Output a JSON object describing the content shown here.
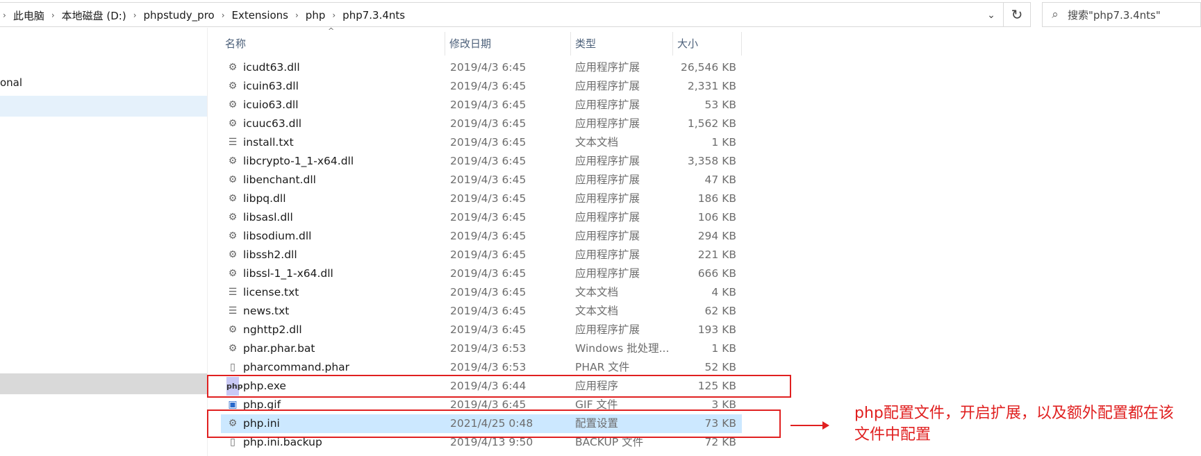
{
  "address": {
    "crumbs": [
      "此电脑",
      "本地磁盘 (D:)",
      "phpstudy_pro",
      "Extensions",
      "php",
      "php7.3.4nts"
    ],
    "dropdown_glyph": "⌄",
    "refresh_glyph": "↻"
  },
  "search": {
    "placeholder": "搜索\"php7.3.4nts\""
  },
  "nav": {
    "partial_item": "onal"
  },
  "columns": {
    "name": "名称",
    "date": "修改日期",
    "type": "类型",
    "size": "大小"
  },
  "files": [
    {
      "name": "icudt63.dll",
      "date": "2019/4/3 6:45",
      "type": "应用程序扩展",
      "size": "26,546 KB",
      "icon": "dll-icon"
    },
    {
      "name": "icuin63.dll",
      "date": "2019/4/3 6:45",
      "type": "应用程序扩展",
      "size": "2,331 KB",
      "icon": "dll-icon"
    },
    {
      "name": "icuio63.dll",
      "date": "2019/4/3 6:45",
      "type": "应用程序扩展",
      "size": "53 KB",
      "icon": "dll-icon"
    },
    {
      "name": "icuuc63.dll",
      "date": "2019/4/3 6:45",
      "type": "应用程序扩展",
      "size": "1,562 KB",
      "icon": "dll-icon"
    },
    {
      "name": "install.txt",
      "date": "2019/4/3 6:45",
      "type": "文本文档",
      "size": "1 KB",
      "icon": "text-file-icon"
    },
    {
      "name": "libcrypto-1_1-x64.dll",
      "date": "2019/4/3 6:45",
      "type": "应用程序扩展",
      "size": "3,358 KB",
      "icon": "dll-icon"
    },
    {
      "name": "libenchant.dll",
      "date": "2019/4/3 6:45",
      "type": "应用程序扩展",
      "size": "47 KB",
      "icon": "dll-icon"
    },
    {
      "name": "libpq.dll",
      "date": "2019/4/3 6:45",
      "type": "应用程序扩展",
      "size": "186 KB",
      "icon": "dll-icon"
    },
    {
      "name": "libsasl.dll",
      "date": "2019/4/3 6:45",
      "type": "应用程序扩展",
      "size": "106 KB",
      "icon": "dll-icon"
    },
    {
      "name": "libsodium.dll",
      "date": "2019/4/3 6:45",
      "type": "应用程序扩展",
      "size": "294 KB",
      "icon": "dll-icon"
    },
    {
      "name": "libssh2.dll",
      "date": "2019/4/3 6:45",
      "type": "应用程序扩展",
      "size": "221 KB",
      "icon": "dll-icon"
    },
    {
      "name": "libssl-1_1-x64.dll",
      "date": "2019/4/3 6:45",
      "type": "应用程序扩展",
      "size": "666 KB",
      "icon": "dll-icon"
    },
    {
      "name": "license.txt",
      "date": "2019/4/3 6:45",
      "type": "文本文档",
      "size": "4 KB",
      "icon": "text-file-icon"
    },
    {
      "name": "news.txt",
      "date": "2019/4/3 6:45",
      "type": "文本文档",
      "size": "62 KB",
      "icon": "text-file-icon"
    },
    {
      "name": "nghttp2.dll",
      "date": "2019/4/3 6:45",
      "type": "应用程序扩展",
      "size": "193 KB",
      "icon": "dll-icon"
    },
    {
      "name": "phar.phar.bat",
      "date": "2019/4/3 6:53",
      "type": "Windows 批处理...",
      "size": "1 KB",
      "icon": "batch-file-icon"
    },
    {
      "name": "pharcommand.phar",
      "date": "2019/4/3 6:53",
      "type": "PHAR 文件",
      "size": "52 KB",
      "icon": "blank-file-icon"
    },
    {
      "name": "php.exe",
      "date": "2019/4/3 6:44",
      "type": "应用程序",
      "size": "125 KB",
      "icon": "php-exe-icon"
    },
    {
      "name": "php.gif",
      "date": "2019/4/3 6:45",
      "type": "GIF 文件",
      "size": "3 KB",
      "icon": "image-file-icon"
    },
    {
      "name": "php.ini",
      "date": "2021/4/25 0:48",
      "type": "配置设置",
      "size": "73 KB",
      "icon": "settings-file-icon"
    },
    {
      "name": "php.ini.backup",
      "date": "2019/4/13 9:50",
      "type": "BACKUP 文件",
      "size": "72 KB",
      "icon": "blank-file-icon"
    }
  ],
  "annotation": {
    "text": "php配置文件，开启扩展，以及额外配置都在该文件中配置"
  },
  "colors": {
    "highlight": "#e02020",
    "selection": "#cce8ff"
  }
}
